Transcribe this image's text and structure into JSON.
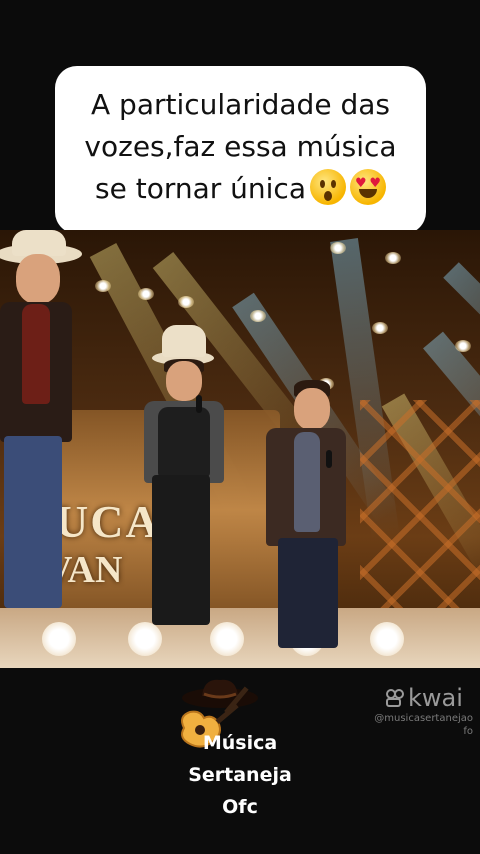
{
  "caption": {
    "line1": "A particularidade das",
    "line2": "vozes,faz essa música",
    "line3": "se tornar única",
    "emojis": [
      "astonished-face",
      "heart-eyes-face"
    ]
  },
  "stage": {
    "logo_line1": "UCA",
    "logo_line2": "VAN"
  },
  "brand": {
    "line1": "Música",
    "line2": "Sertaneja",
    "line3": "Ofc",
    "icon": "guitar-with-cowboy-hat"
  },
  "watermark": {
    "logo": "kwai",
    "handle_line1": "@musicasertanejao",
    "handle_line2": "fo"
  },
  "colors": {
    "background": "#000000",
    "caption_bg": "#ffffff",
    "caption_text": "#111111",
    "brand_text": "#ffffff",
    "watermark": "#9a9a9a"
  }
}
